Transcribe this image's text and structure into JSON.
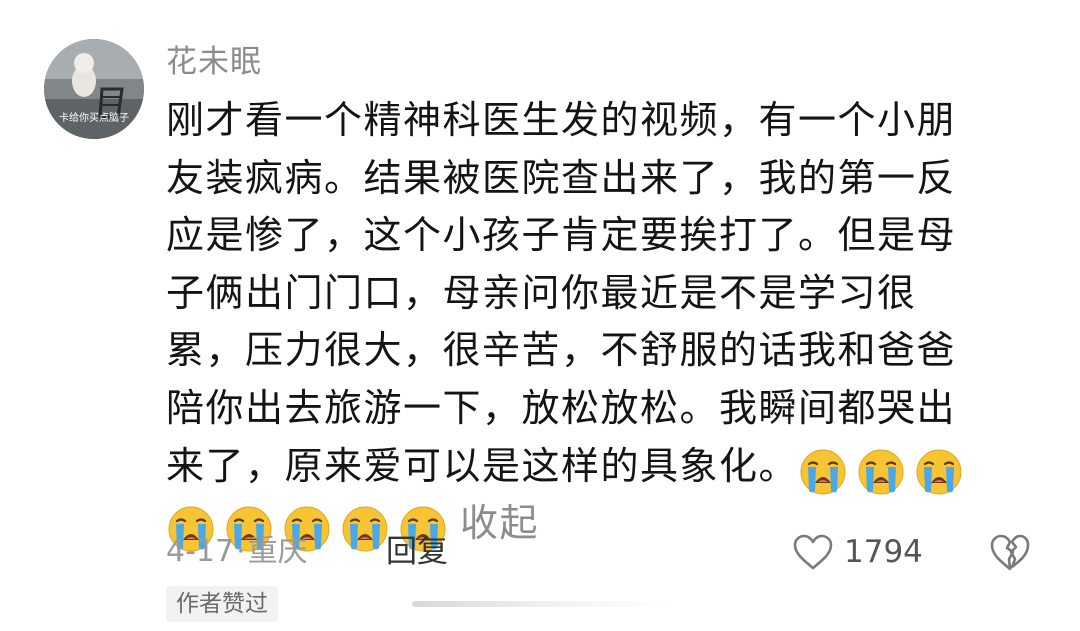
{
  "user": {
    "name": "花未眠",
    "avatar_caption": "卡给你买点脑子"
  },
  "comment": {
    "lines": [
      "刚才看一个精神科医生发的视频，有一个小朋",
      "友装疯病。结果被医院查出来了，我的第一反",
      "应是惨了，这个小孩子肯定要挨打了。但是母",
      "子俩出门门口，母亲问你最近是不是学习很",
      "累，压力很大，很辛苦，不舒服的话我和爸爸",
      "陪你出去旅游一下，放松放松。我瞬间都哭出",
      "来了，原来爱可以是这样的具象化。"
    ],
    "emoji_name": "loudly-crying-face",
    "collapse_label": "收起"
  },
  "meta": {
    "date": "4-17",
    "separator": "·",
    "location": "重庆",
    "reply_label": "回复",
    "like_count": "1794",
    "author_badge": "作者赞过"
  },
  "icons": {
    "like": "heart-outline-icon",
    "dislike": "broken-heart-icon"
  },
  "colors": {
    "text_primary": "#141414",
    "text_secondary": "#8c8c8c",
    "emoji_face": "#f7c433",
    "emoji_tears": "#4aa8e8"
  }
}
